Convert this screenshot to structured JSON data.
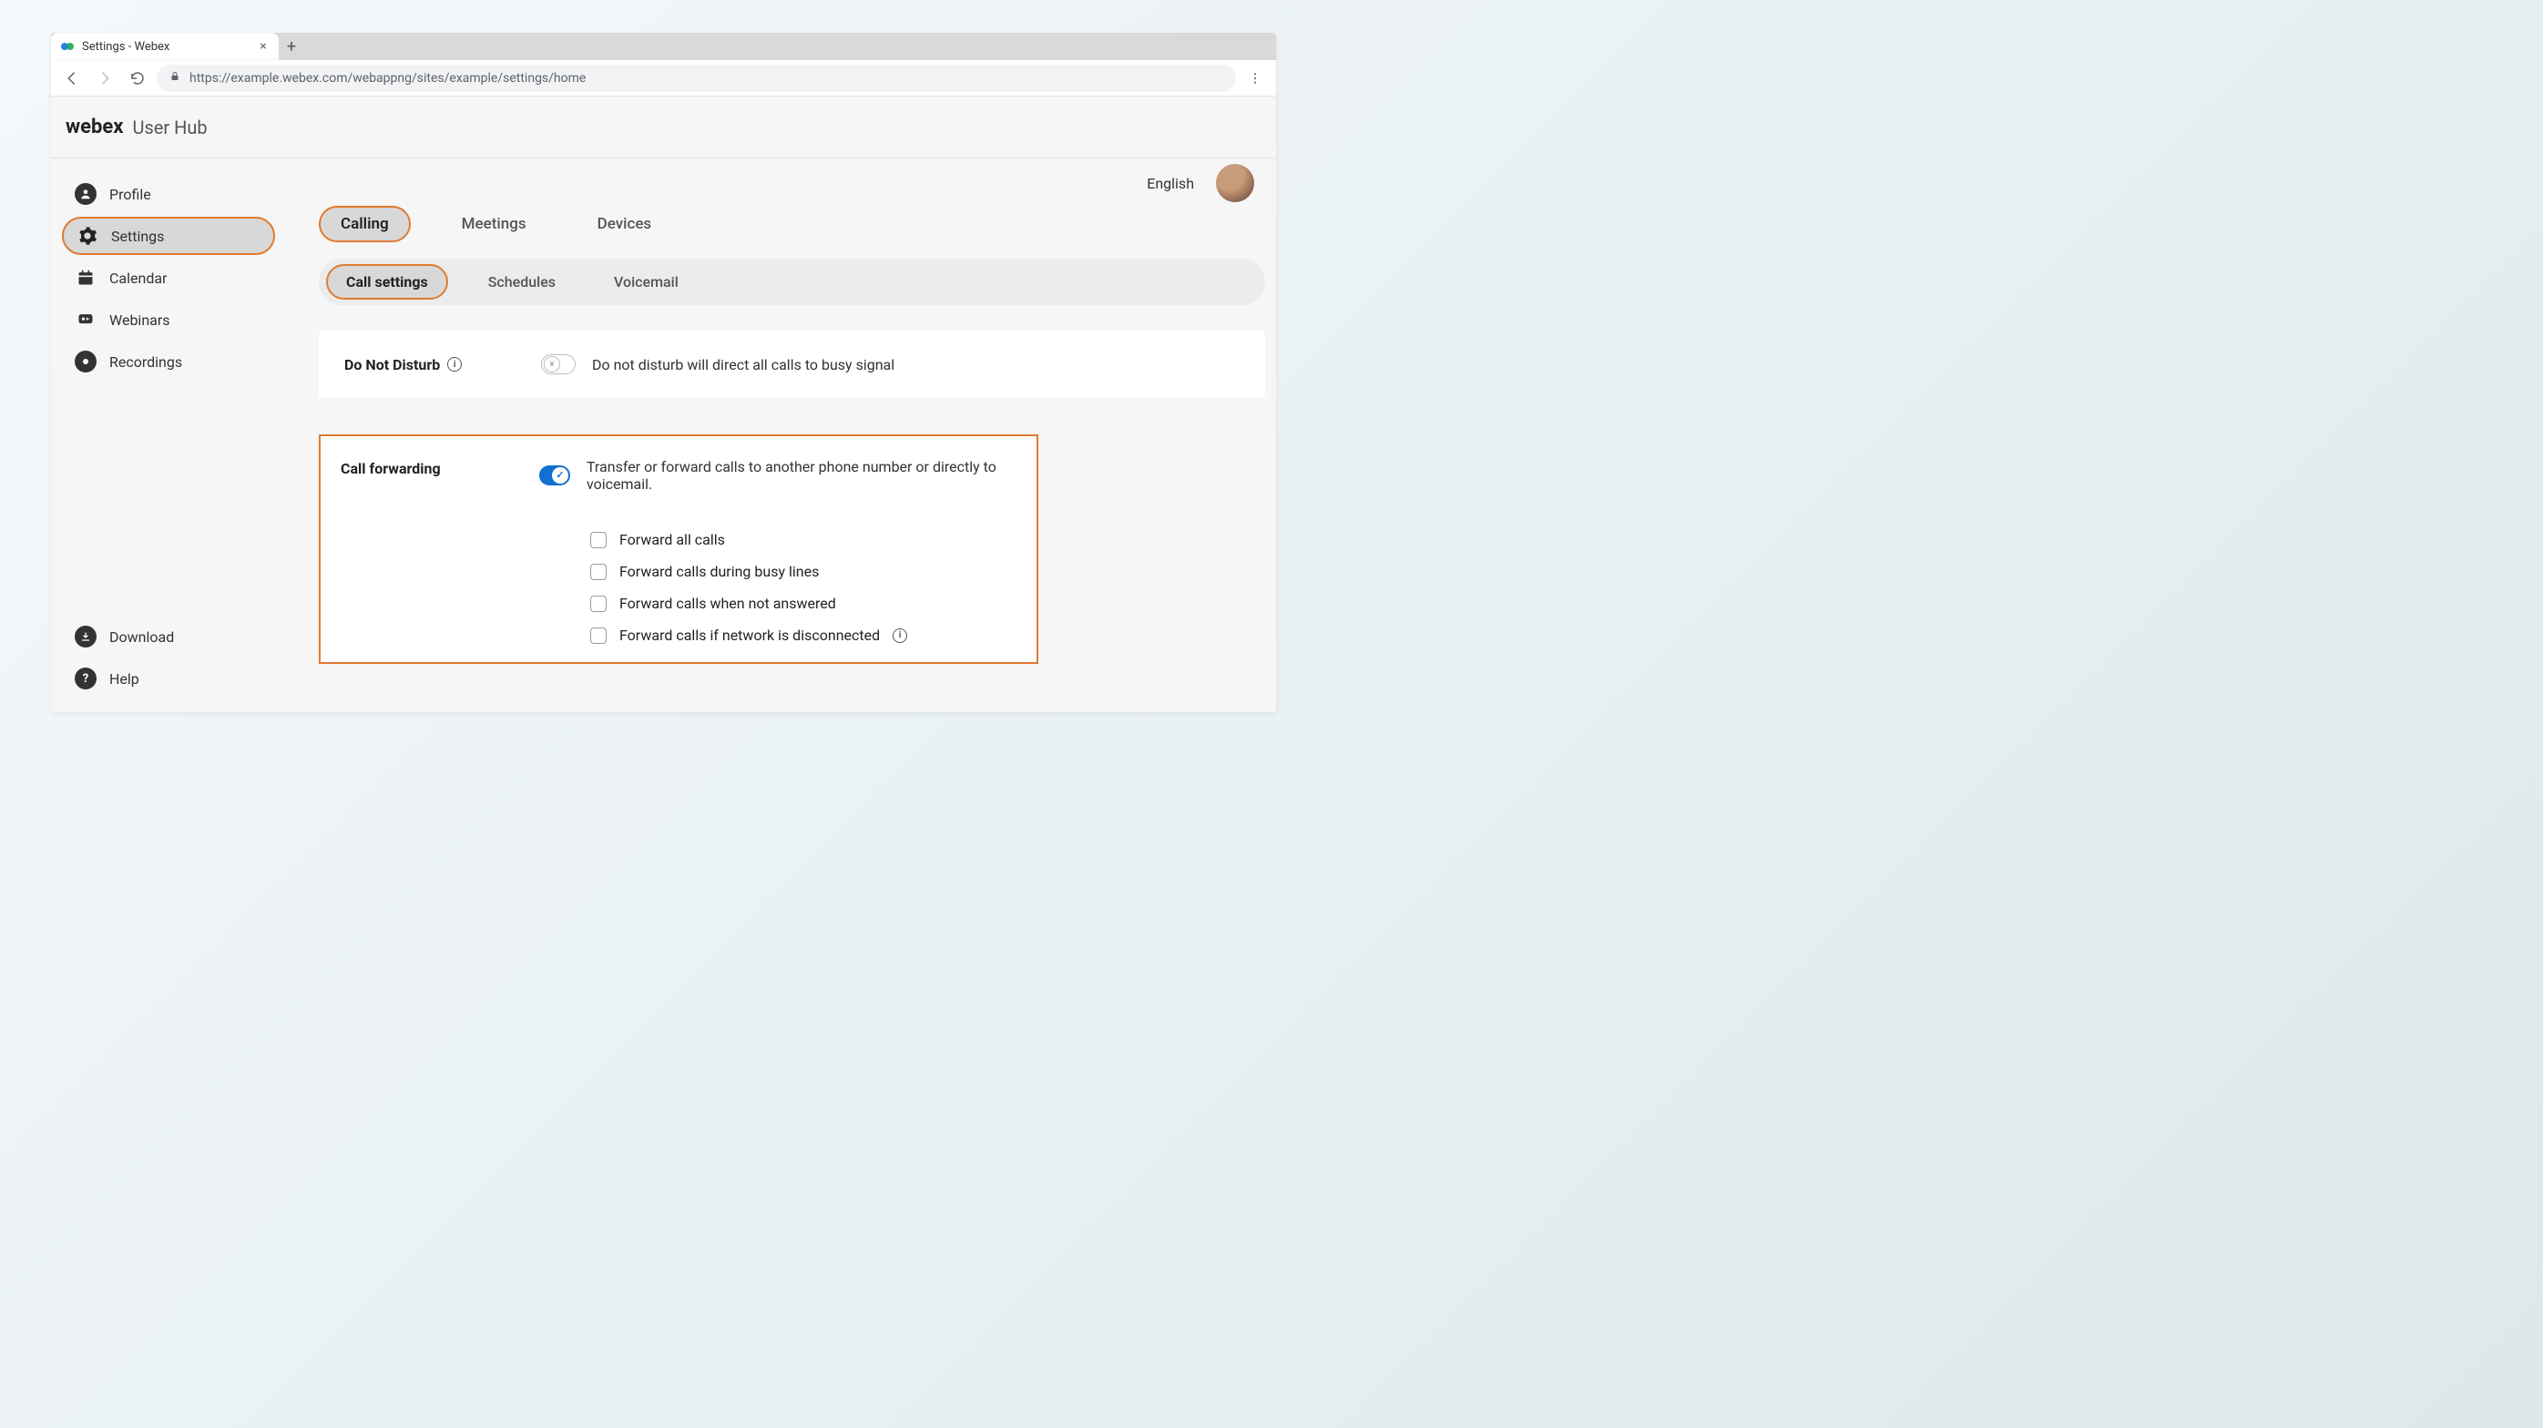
{
  "browser": {
    "tab_title": "Settings - Webex",
    "url": "https://example.webex.com/webappng/sites/example/settings/home"
  },
  "header": {
    "brand": "webex",
    "sub": "User Hub",
    "language": "English"
  },
  "sidebar": {
    "items": [
      {
        "label": "Profile"
      },
      {
        "label": "Settings"
      },
      {
        "label": "Calendar"
      },
      {
        "label": "Webinars"
      },
      {
        "label": "Recordings"
      }
    ],
    "bottom": [
      {
        "label": "Download"
      },
      {
        "label": "Help"
      }
    ]
  },
  "tabs": {
    "primary": [
      {
        "label": "Calling"
      },
      {
        "label": "Meetings"
      },
      {
        "label": "Devices"
      }
    ],
    "secondary": [
      {
        "label": "Call settings"
      },
      {
        "label": "Schedules"
      },
      {
        "label": "Voicemail"
      }
    ]
  },
  "dnd": {
    "title": "Do Not Disturb",
    "desc": "Do not disturb will direct all calls to busy signal"
  },
  "cf": {
    "title": "Call forwarding",
    "desc": "Transfer or forward calls to another phone number or directly to voicemail.",
    "options": [
      "Forward all calls",
      "Forward calls during busy lines",
      "Forward calls when not answered",
      "Forward calls if network is disconnected"
    ]
  }
}
